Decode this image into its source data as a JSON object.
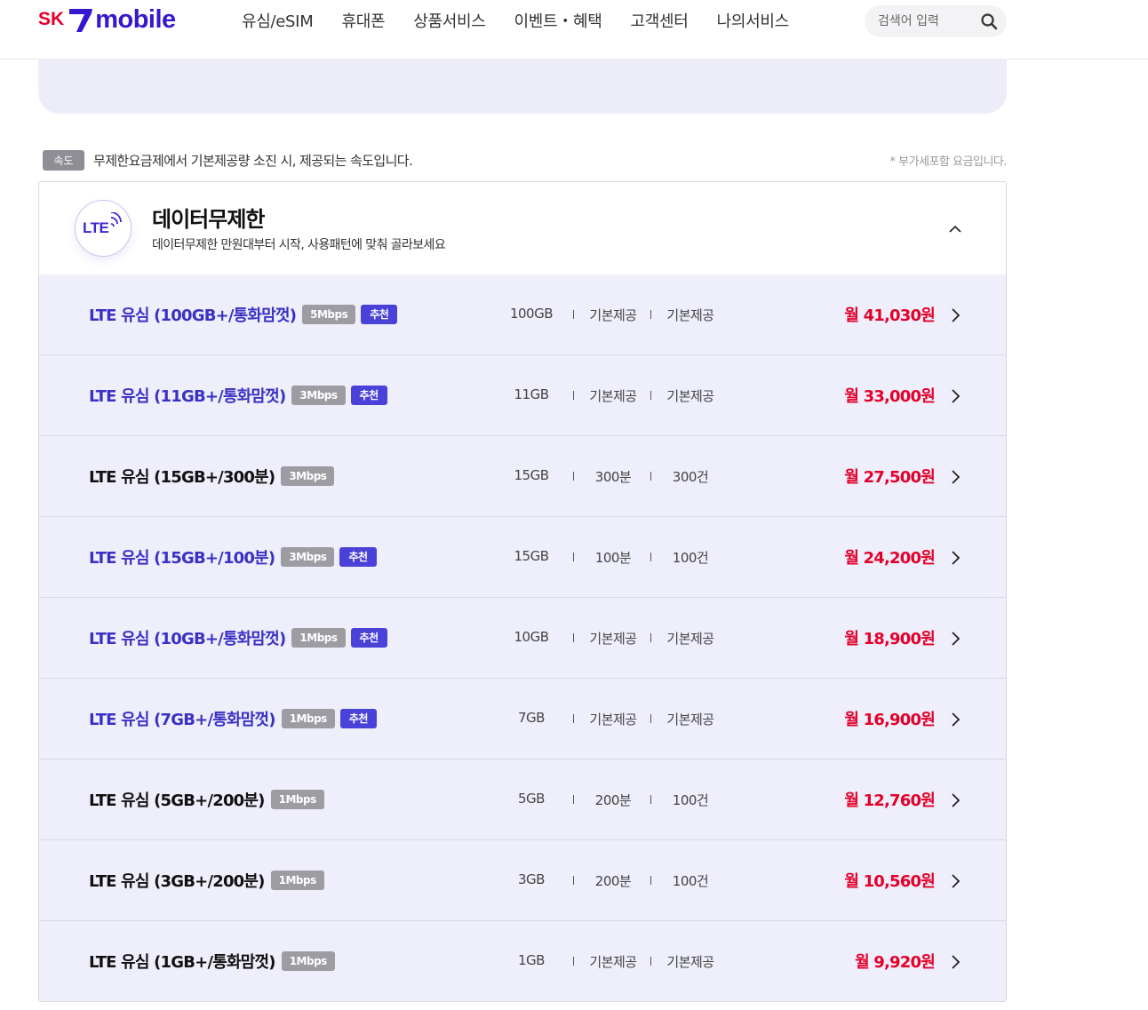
{
  "header": {
    "logo_sk": "SK",
    "logo_mobile": "mobile",
    "nav": [
      "유심/eSIM",
      "휴대폰",
      "상품서비스",
      "이벤트・혜택",
      "고객센터",
      "나의서비스"
    ],
    "search_placeholder": "검색어 입력"
  },
  "info": {
    "speed_tag": "속도",
    "text": "무제한요금제에서 기본제공량 소진 시, 제공되는 속도입니다.",
    "note": "* 부가세포함 요금입니다."
  },
  "section": {
    "badge": "LTE",
    "title": "데이터무제한",
    "desc": "데이터무제한 만원대부터 시작, 사용패턴에 맞춰 골라보세요"
  },
  "plans": [
    {
      "name": "LTE 유심 (100GB+/통화맘껏)",
      "speed": "5Mbps",
      "rec": "추천",
      "data": "100GB",
      "call": "기본제공",
      "sms": "기본제공",
      "price": "월 41,030원"
    },
    {
      "name": "LTE 유심 (11GB+/통화맘껏)",
      "speed": "3Mbps",
      "rec": "추천",
      "data": "11GB",
      "call": "기본제공",
      "sms": "기본제공",
      "price": "월 33,000원"
    },
    {
      "name": "LTE 유심 (15GB+/300분)",
      "speed": "3Mbps",
      "rec": "",
      "data": "15GB",
      "call": "300분",
      "sms": "300건",
      "price": "월 27,500원"
    },
    {
      "name": "LTE 유심 (15GB+/100분)",
      "speed": "3Mbps",
      "rec": "추천",
      "data": "15GB",
      "call": "100분",
      "sms": "100건",
      "price": "월 24,200원"
    },
    {
      "name": "LTE 유심 (10GB+/통화맘껏)",
      "speed": "1Mbps",
      "rec": "추천",
      "data": "10GB",
      "call": "기본제공",
      "sms": "기본제공",
      "price": "월 18,900원"
    },
    {
      "name": "LTE 유심 (7GB+/통화맘껏)",
      "speed": "1Mbps",
      "rec": "추천",
      "data": "7GB",
      "call": "기본제공",
      "sms": "기본제공",
      "price": "월 16,900원"
    },
    {
      "name": "LTE 유심 (5GB+/200분)",
      "speed": "1Mbps",
      "rec": "",
      "data": "5GB",
      "call": "200분",
      "sms": "100건",
      "price": "월 12,760원"
    },
    {
      "name": "LTE 유심 (3GB+/200분)",
      "speed": "1Mbps",
      "rec": "",
      "data": "3GB",
      "call": "200분",
      "sms": "100건",
      "price": "월 10,560원"
    },
    {
      "name": "LTE 유심 (1GB+/통화맘껏)",
      "speed": "1Mbps",
      "rec": "",
      "data": "1GB",
      "call": "기본제공",
      "sms": "기본제공",
      "price": "월 9,920원"
    }
  ],
  "colors": {
    "brand_red": "#e4002b",
    "brand_purple": "#3617ce",
    "recommended_name": "#3b30c4",
    "rec_badge": "#4a42d8",
    "row_bg": "#eeeffa"
  },
  "icons": {
    "search": "search-icon",
    "collapse": "chevron-up-icon",
    "row": "chevron-right-icon",
    "signal": "signal-wave-icon"
  }
}
